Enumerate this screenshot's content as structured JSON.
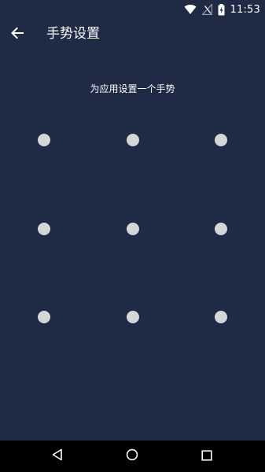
{
  "status_bar": {
    "time": "11:53",
    "icons": [
      "wifi-icon",
      "no-signal-icon",
      "battery-charging-icon"
    ]
  },
  "app_bar": {
    "back_icon": "arrow-left-icon",
    "title": "手势设置"
  },
  "main": {
    "prompt": "为应用设置一个手势",
    "pattern": {
      "rows": 3,
      "cols": 3,
      "selected": [],
      "dot_color": "#d6d6d6"
    }
  },
  "nav_bar": {
    "buttons": [
      "back-triangle-icon",
      "home-circle-icon",
      "recents-square-icon"
    ]
  },
  "colors": {
    "background": "#1f2a45",
    "text": "#ffffff",
    "nav_background": "#000000"
  }
}
